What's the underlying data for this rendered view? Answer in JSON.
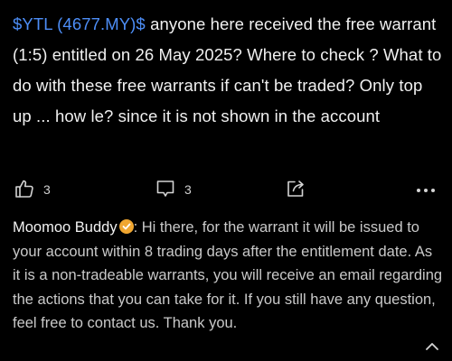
{
  "post": {
    "ticker": "$YTL (4677.MY)$",
    "text": " anyone here received the free warrant (1:5) entitled on 26 May 2025? Where to check ? What to do with these free warrants if can't be traded? Only top up ... how le? since it is not shown in the account"
  },
  "actions": {
    "like_count": "3",
    "comment_count": "3"
  },
  "reply": {
    "author": "Moomoo Buddy",
    "text": ": Hi there, for the warrant it will be issued to your account within 8 trading days after the entitlement date. As it is a non-tradeable warrants, you will receive an email regarding the actions that you can take for it. If you still have any question, feel free to contact us. Thank you."
  },
  "icons": {
    "like": "thumbs-up-icon",
    "comment": "comment-icon",
    "share": "share-icon",
    "more": "more-dots-icon",
    "badge": "verified-badge-icon",
    "collapse": "chevron-up-icon"
  },
  "colors": {
    "background": "#000000",
    "ticker": "#4d8ef7",
    "badge": "#f0a630"
  }
}
